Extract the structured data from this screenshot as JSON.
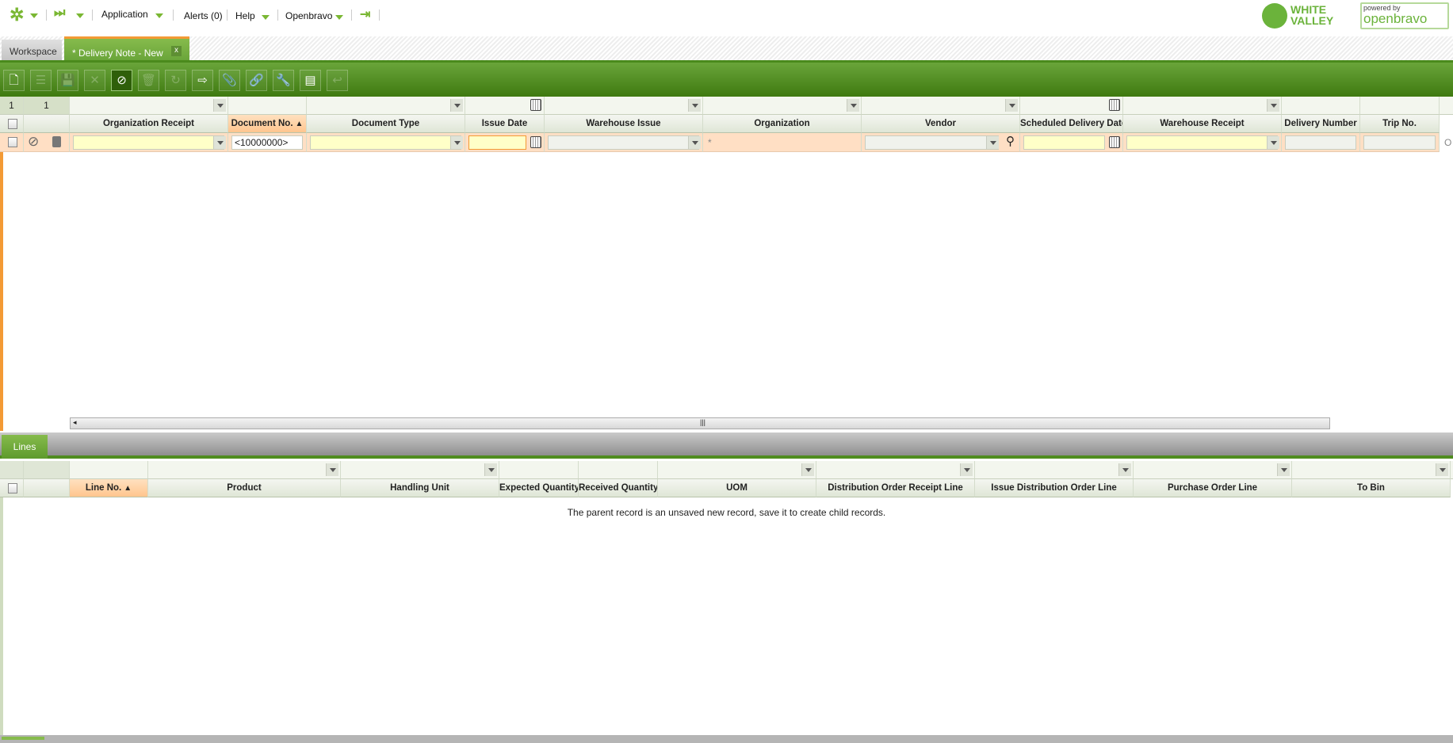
{
  "nav": {
    "application": "Application",
    "alerts": "Alerts (0)",
    "help": "Help",
    "user": "Openbravo"
  },
  "logos": {
    "white_valley": "WHITE VALLEY",
    "powered_by": "powered by",
    "openbravo": "openbravo"
  },
  "tabs": {
    "workspace": "Workspace",
    "active": "* Delivery Note - New",
    "close": "x"
  },
  "header_grid": {
    "counts": [
      "1",
      "1"
    ],
    "columns": [
      "Organization Receipt",
      "Document No.",
      "Document Type",
      "Issue Date",
      "Warehouse Issue",
      "Organization",
      "Vendor",
      "Scheduled Delivery Date",
      "Warehouse Receipt",
      "Delivery Number",
      "Trip No."
    ],
    "sort_indicator": "▲",
    "new_row": {
      "document_no": "<10000000>",
      "organization": "*",
      "last": "O"
    }
  },
  "lines": {
    "tab": "Lines",
    "columns": [
      "Line No.",
      "Product",
      "Handling Unit",
      "Expected Quantity",
      "Received Quantity",
      "UOM",
      "Distribution Order Receipt Line",
      "Issue Distribution Order Line",
      "Purchase Order Line",
      "To Bin"
    ],
    "message": "The parent record is an unsaved new record, save it to create child records."
  },
  "colors": {
    "accent": "#7ab733",
    "toolbar": "#4a8a1c",
    "selected_col": "#ffc58e",
    "required": "#ffffc8"
  }
}
